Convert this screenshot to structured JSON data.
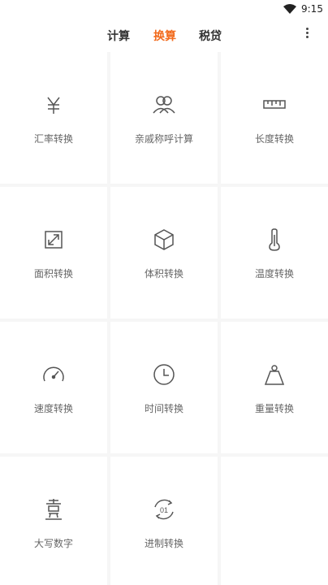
{
  "status_bar": {
    "time": "9:15"
  },
  "header": {
    "tabs": [
      {
        "label": "计算",
        "active": false
      },
      {
        "label": "换算",
        "active": true
      },
      {
        "label": "税贷",
        "active": false
      }
    ]
  },
  "converters": [
    {
      "label": "汇率转换",
      "icon": "yen-icon"
    },
    {
      "label": "亲戚称呼计算",
      "icon": "people-icon"
    },
    {
      "label": "长度转换",
      "icon": "ruler-icon"
    },
    {
      "label": "面积转换",
      "icon": "area-icon"
    },
    {
      "label": "体积转换",
      "icon": "cube-icon"
    },
    {
      "label": "温度转换",
      "icon": "thermometer-icon"
    },
    {
      "label": "速度转换",
      "icon": "speedometer-icon"
    },
    {
      "label": "时间转换",
      "icon": "clock-icon"
    },
    {
      "label": "重量转换",
      "icon": "weight-icon"
    },
    {
      "label": "大写数字",
      "icon": "chinese-numeral-icon"
    },
    {
      "label": "进制转换",
      "icon": "binary-icon"
    }
  ],
  "colors": {
    "accent": "#f26b1d",
    "text": "#333333",
    "label": "#666666",
    "grid_bg": "#f6f6f6"
  }
}
